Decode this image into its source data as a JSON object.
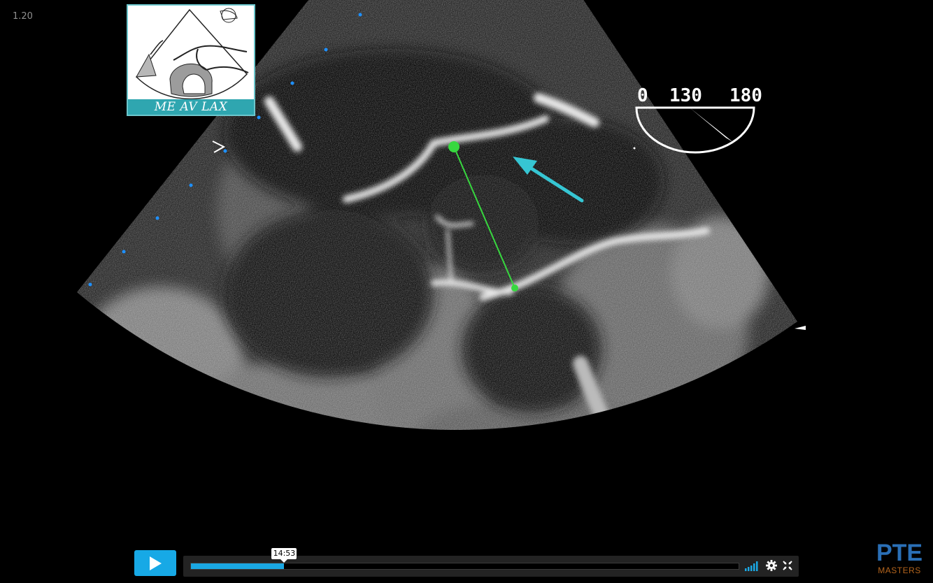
{
  "corner_label": "1.20",
  "view_card": {
    "caption": "ME AV LAX"
  },
  "angle": {
    "min": "0",
    "current": "130",
    "max": "180",
    "fraction": 0.722
  },
  "player": {
    "time": "14:53",
    "progress": 0.17,
    "play_icon": "play-icon",
    "volume_icon": "volume-bars-icon",
    "settings_icon": "gear-icon",
    "fullscreen_icon": "fullscreen-icon"
  },
  "brand": {
    "mark": "PTE",
    "text": "MASTERS"
  },
  "colors": {
    "accent": "#17a9e6",
    "measure": "#37d83f",
    "arrow": "#36c6d3",
    "brand_orange": "#b5651d"
  }
}
